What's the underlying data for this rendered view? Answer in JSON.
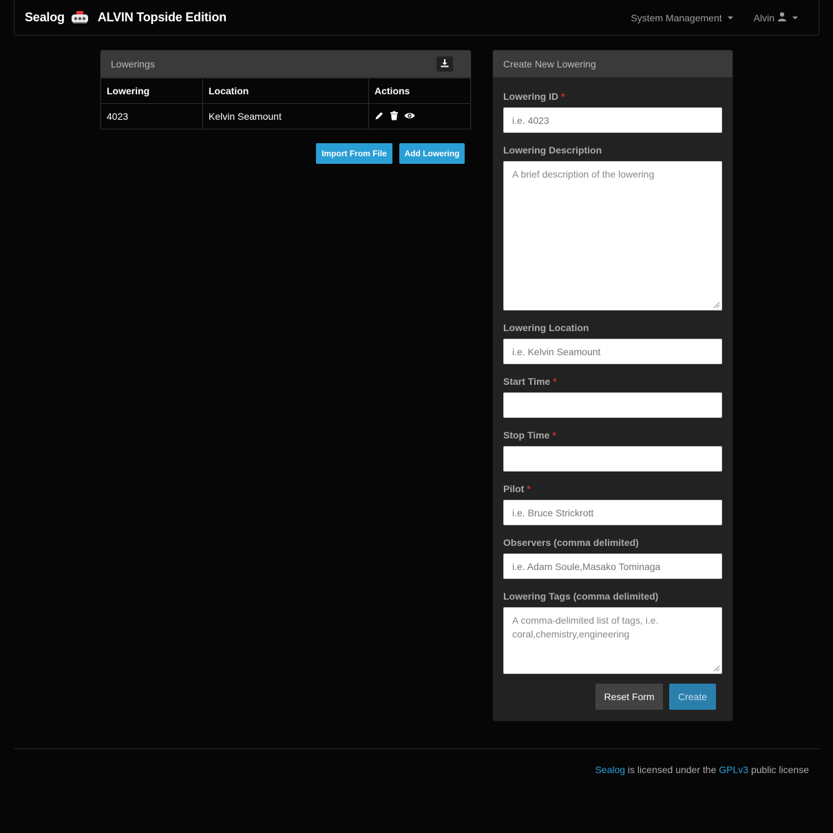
{
  "navbar": {
    "brand": "Sealog",
    "brand_sub": "ALVIN Topside Edition",
    "brand_icon": "submarine-icon",
    "system_management": "System Management",
    "user": "Alvin",
    "user_icon": "user-icon"
  },
  "lowerings": {
    "title": "Lowerings",
    "download_icon": "download-icon",
    "columns": [
      "Lowering",
      "Location",
      "Actions"
    ],
    "rows": [
      {
        "lowering": "4023",
        "location": "Kelvin Seamount",
        "actions": [
          "edit-icon",
          "trash-icon",
          "eye-icon"
        ]
      }
    ],
    "import_button": "Import From File",
    "add_button": "Add Lowering"
  },
  "create": {
    "title": "Create New Lowering",
    "required_mark": "*",
    "lowering_id": {
      "label": "Lowering ID",
      "placeholder": "i.e. 4023",
      "value": ""
    },
    "description": {
      "label": "Lowering Description",
      "placeholder": "A brief description of the lowering",
      "value": ""
    },
    "location": {
      "label": "Lowering Location",
      "placeholder": "i.e. Kelvin Seamount",
      "value": ""
    },
    "start_time": {
      "label": "Start Time",
      "value": ""
    },
    "stop_time": {
      "label": "Stop Time",
      "value": ""
    },
    "pilot": {
      "label": "Pilot",
      "placeholder": "i.e. Bruce Strickrott",
      "value": ""
    },
    "observers": {
      "label": "Observers (comma delimited)",
      "placeholder": "i.e. Adam Soule,Masako Tominaga",
      "value": ""
    },
    "tags": {
      "label": "Lowering Tags (comma delimited)",
      "placeholder": "A comma-delimited list of tags, i.e. coral,chemistry,engineering",
      "value": ""
    },
    "reset_button": "Reset Form",
    "create_button": "Create"
  },
  "footer": {
    "sealog_link": "Sealog",
    "text1": " is licensed under the ",
    "gpl_link": "GPLv3",
    "text2": " public license"
  },
  "colors": {
    "accent": "#2a9fd6",
    "required": "#c9302c",
    "background": "#060606",
    "panel": "#222222"
  }
}
